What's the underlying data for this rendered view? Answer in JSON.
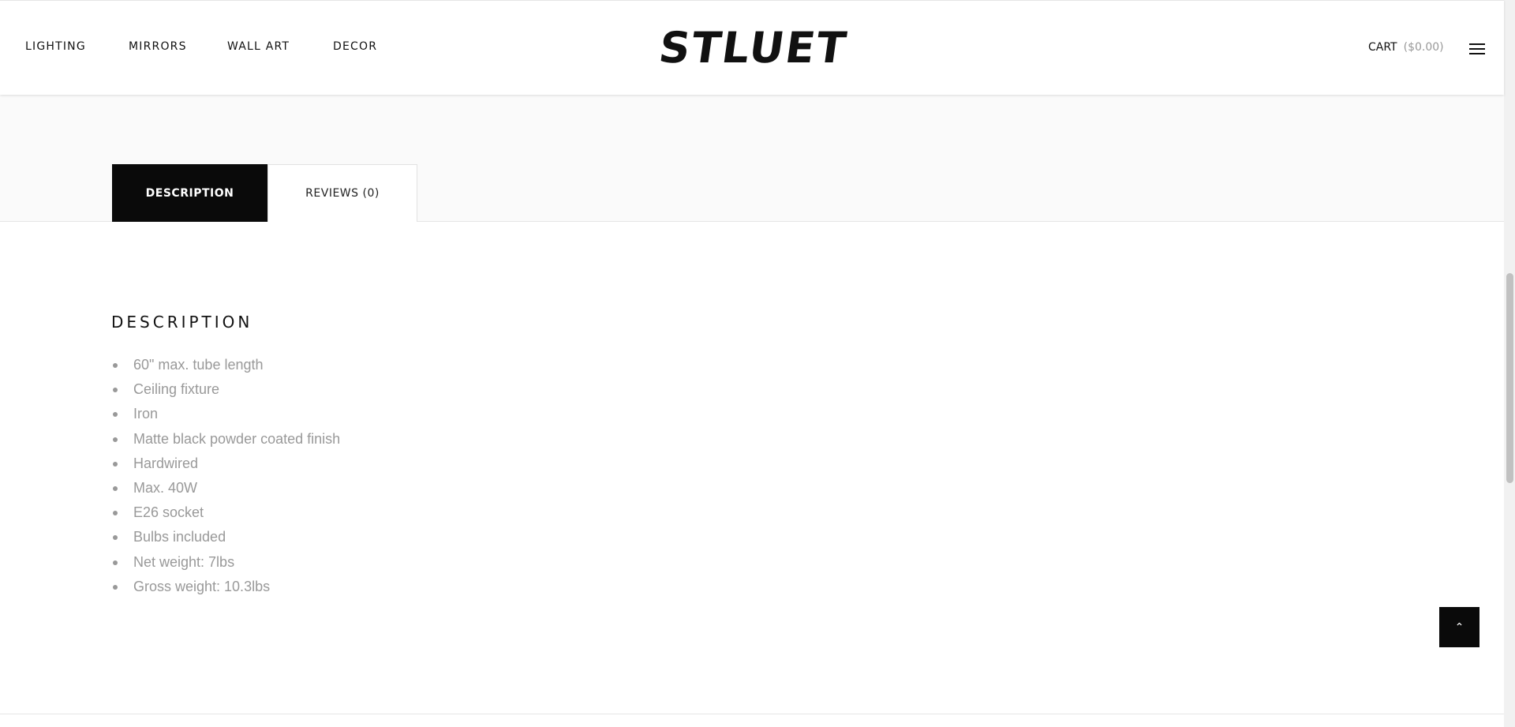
{
  "header": {
    "nav": [
      {
        "label": "LIGHTING"
      },
      {
        "label": "MIRRORS"
      },
      {
        "label": "WALL ART"
      },
      {
        "label": "DECOR"
      }
    ],
    "logo": "STLUET",
    "cart_label": "CART",
    "cart_amount": "($0.00)",
    "menu_icon": "hamburger-icon"
  },
  "tabs": [
    {
      "label": "DESCRIPTION",
      "active": true
    },
    {
      "label": "REVIEWS (0)",
      "active": false
    }
  ],
  "description": {
    "heading": "DESCRIPTION",
    "items": [
      "60\" max. tube length",
      "Ceiling fixture",
      "Iron",
      "Matte black powder coated finish",
      "Hardwired",
      "Max. 40W",
      "E26 socket",
      "Bulbs included",
      "Net weight: 7lbs",
      "Gross weight: 10.3lbs"
    ]
  },
  "back_to_top": {
    "icon": "chevron-up-icon",
    "glyph": "⌃"
  }
}
